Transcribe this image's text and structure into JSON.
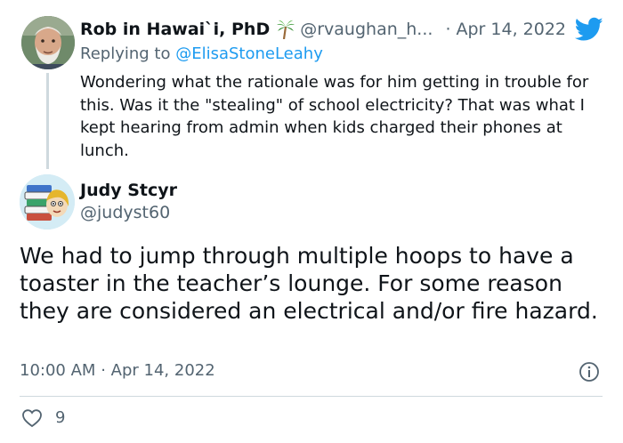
{
  "parent_tweet": {
    "author_name": "Rob in Hawai`i, PhD",
    "handle": "@rvaughan_h...",
    "separator": "·",
    "date": "Apr 14, 2022",
    "replying_prefix": "Replying to ",
    "replying_to": "@ElisaStoneLeahy",
    "text": "Wondering what the rationale was for him getting in trouble for this. Was it the \"stealing\" of school electricity? That was what I kept hearing from admin when kids charged their phones at lunch.",
    "emoji_icon": "palm-tree-icon"
  },
  "main_tweet": {
    "author_name": "Judy Stcyr",
    "handle": "@judyst60",
    "text": "We had to jump through multiple hoops to have a toaster in the teacher’s lounge. For some reason they are considered an electrical and/or fire hazard.",
    "time": "10:00 AM",
    "separator": "·",
    "date": "Apr 14, 2022",
    "like_count": "9"
  },
  "colors": {
    "accent": "#1d9bf0",
    "muted_text": "#536471",
    "divider": "#cfd9de"
  },
  "icons": {
    "brand": "twitter-bird-icon",
    "info": "info-icon",
    "like": "heart-icon"
  }
}
